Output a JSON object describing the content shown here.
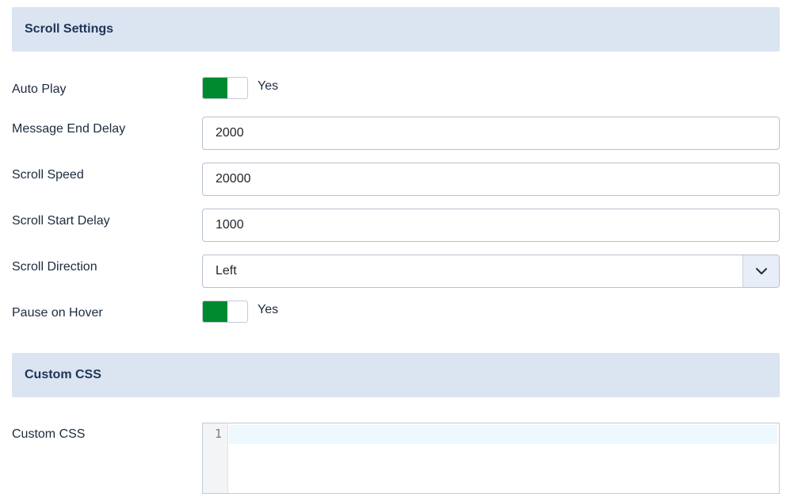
{
  "scroll_settings": {
    "title": "Scroll Settings",
    "auto_play": {
      "label": "Auto Play",
      "value": "Yes",
      "on": true
    },
    "message_end_delay": {
      "label": "Message End Delay",
      "value": "2000"
    },
    "scroll_speed": {
      "label": "Scroll Speed",
      "value": "20000"
    },
    "scroll_start_delay": {
      "label": "Scroll Start Delay",
      "value": "1000"
    },
    "scroll_direction": {
      "label": "Scroll Direction",
      "value": "Left"
    },
    "pause_on_hover": {
      "label": "Pause on Hover",
      "value": "Yes",
      "on": true
    }
  },
  "custom_css": {
    "title": "Custom CSS",
    "label": "Custom CSS",
    "line_number": "1",
    "content": ""
  },
  "colors": {
    "toggle_on": "#008a2e",
    "section_header_bg": "#dbe4f1",
    "section_header_text": "#1d3558"
  },
  "icons": {
    "select_caret": "chevron-down-icon"
  }
}
